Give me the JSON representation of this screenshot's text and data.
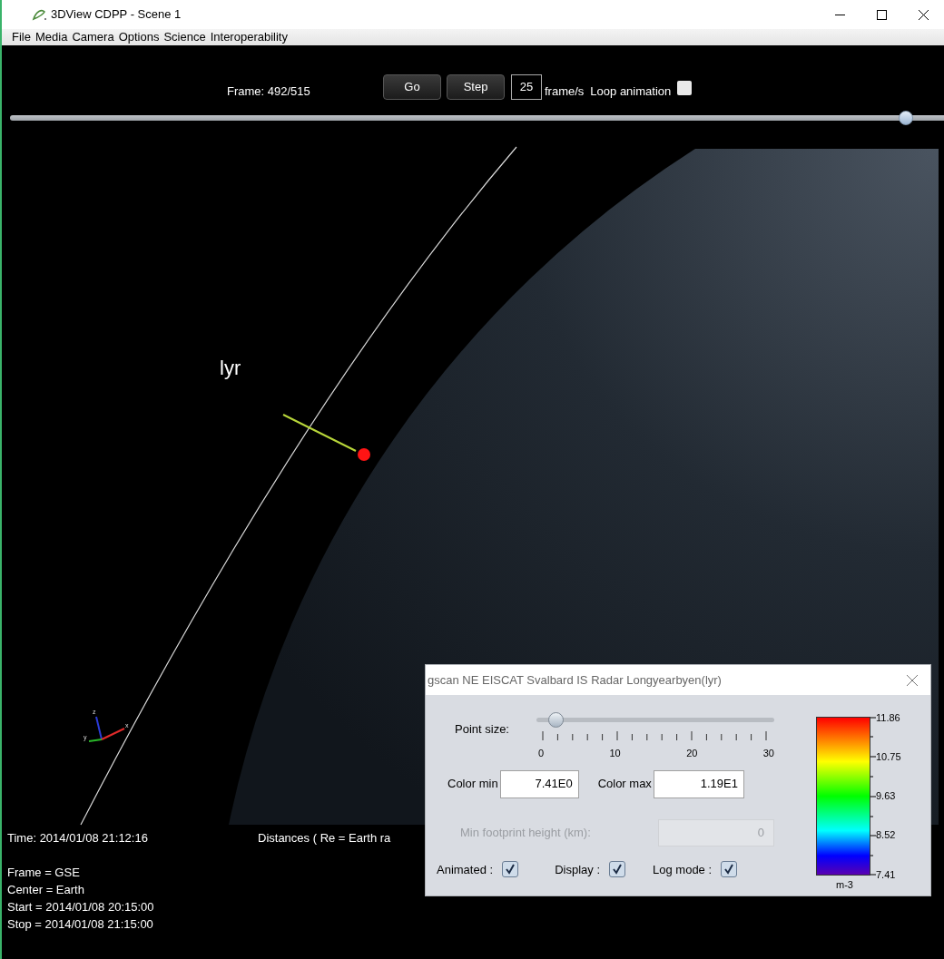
{
  "window": {
    "title": "3DView CDPP - Scene 1"
  },
  "menu": [
    "File",
    "Media",
    "Camera",
    "Options",
    "Science",
    "Interoperability"
  ],
  "animation": {
    "frame_label": "Frame: 492/515",
    "buttons": [
      "Go",
      "Step"
    ],
    "rate": "25",
    "rate_unit": "frame/s",
    "loop": {
      "label": "Loop animation",
      "checked": false
    },
    "level": 0.955
  },
  "scene": {
    "station_label": "lyr",
    "axis_labels": [
      "z",
      "x",
      "y"
    ]
  },
  "info": {
    "time": "Time: 2014/01/08 21:12:16",
    "distances": "Distances ( Re = Earth ra",
    "lines": [
      "Frame = GSE",
      "Center = Earth",
      "Start = 2014/01/08 20:15:00",
      "Stop = 2014/01/08 21:15:00"
    ]
  },
  "dialog": {
    "title": "gscan NE EISCAT Svalbard IS Radar Longyearbyen(lyr)",
    "point_size": {
      "label": "Point size:",
      "level": 0.06,
      "ticks": [
        "0",
        "10",
        "20",
        "30"
      ]
    },
    "color_min": {
      "label": "Color min",
      "value": "7.41E0"
    },
    "color_max": {
      "label": "Color max",
      "value": "1.19E1"
    },
    "footprint": {
      "label": "Min footprint height (km):",
      "value": "0",
      "disabled": true
    },
    "checks": [
      {
        "label": "Animated :",
        "checked": true
      },
      {
        "label": "Display :",
        "checked": true
      },
      {
        "label": "Log mode :",
        "checked": true
      }
    ],
    "colorbar": {
      "ticks": [
        "11.86",
        "10.75",
        "9.63",
        "8.52",
        "7.41"
      ],
      "unit": "m-3"
    }
  }
}
